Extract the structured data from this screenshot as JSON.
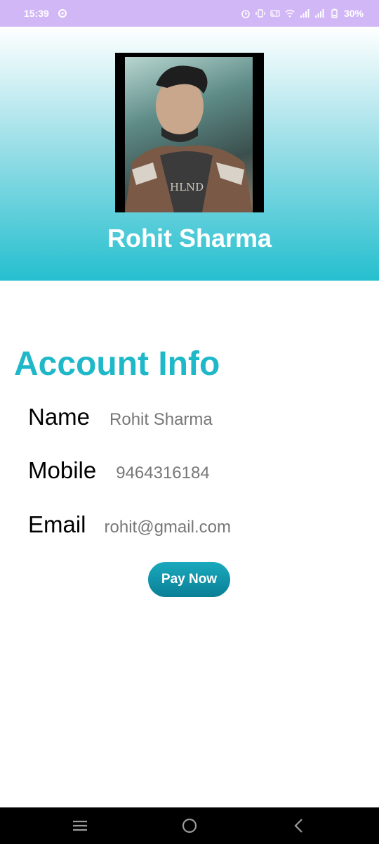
{
  "status_bar": {
    "time": "15:39",
    "battery": "30%",
    "icons": [
      "settings-icon",
      "alarm-icon",
      "vibrate-icon",
      "volte-icon",
      "wifi-icon",
      "signal-icon",
      "signal-icon",
      "battery-icon"
    ]
  },
  "profile": {
    "name": "Rohit Sharma",
    "photo_shirt_text": "HLND"
  },
  "account": {
    "title": "Account Info",
    "fields": [
      {
        "label": "Name",
        "value": "Rohit Sharma"
      },
      {
        "label": "Mobile",
        "value": "9464316184"
      },
      {
        "label": "Email",
        "value": "rohit@gmail.com"
      }
    ]
  },
  "actions": {
    "pay_label": "Pay Now"
  },
  "nav": {
    "icons": [
      "recents-icon",
      "home-icon",
      "back-icon"
    ]
  },
  "colors": {
    "status_bar": "#d2b7f7",
    "accent": "#1fb8c9",
    "button": "#0a7f96"
  }
}
